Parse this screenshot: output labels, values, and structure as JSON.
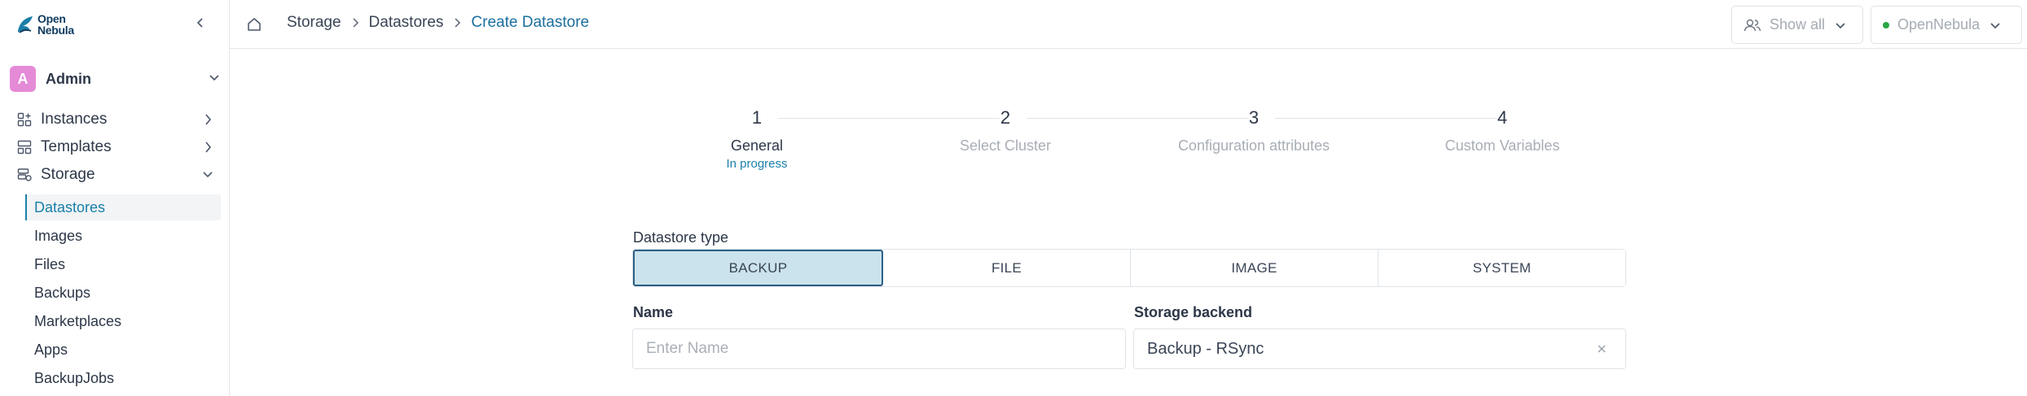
{
  "app": {
    "logo_line1": "Open",
    "logo_line2": "Nebula",
    "brand_color": "#1a7fa8"
  },
  "sidebar": {
    "user": {
      "initial": "A",
      "name": "Admin"
    },
    "items": [
      {
        "label": "Instances",
        "icon": "instances-icon"
      },
      {
        "label": "Templates",
        "icon": "templates-icon"
      },
      {
        "label": "Storage",
        "icon": "storage-icon"
      }
    ],
    "storage_children": [
      {
        "label": "Datastores",
        "active": true
      },
      {
        "label": "Images"
      },
      {
        "label": "Files"
      },
      {
        "label": "Backups"
      },
      {
        "label": "Marketplaces"
      },
      {
        "label": "Apps"
      },
      {
        "label": "BackupJobs"
      }
    ]
  },
  "topbar": {
    "breadcrumb": [
      "Storage",
      "Datastores",
      "Create Datastore"
    ],
    "show_all_label": "Show all",
    "zone_label": "OpenNebula"
  },
  "stepper": {
    "steps": [
      {
        "number": "1",
        "label": "General",
        "status": "In progress"
      },
      {
        "number": "2",
        "label": "Select Cluster"
      },
      {
        "number": "3",
        "label": "Configuration attributes"
      },
      {
        "number": "4",
        "label": "Custom Variables"
      }
    ]
  },
  "form": {
    "datastore_type_label": "Datastore type",
    "datastore_types": [
      "BACKUP",
      "FILE",
      "IMAGE",
      "SYSTEM"
    ],
    "selected_type": "BACKUP",
    "name_label": "Name",
    "name_placeholder": "Enter Name",
    "name_value": "",
    "storage_backend_label": "Storage backend",
    "storage_backend_value": "Backup - RSync"
  }
}
